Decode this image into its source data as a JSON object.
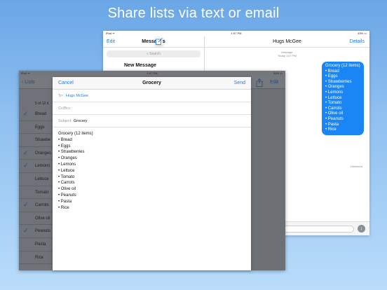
{
  "headline": "Share lists via text or email",
  "messages_ipad": {
    "status": {
      "left": "iPad ᯤ",
      "time": "1:57 PM",
      "battery": "43% ▭"
    },
    "left": {
      "edit": "Edit",
      "title": "Messages",
      "search_placeholder": "Search",
      "new_message": "New Message"
    },
    "right": {
      "contact": "Hugs McGee",
      "details": "Details",
      "meta_service": "Message",
      "meta_time": "Today 1:57 PM",
      "bubble_lines": [
        "Grocery (12 items)",
        "• Bread",
        "• Eggs",
        "• Strawberries",
        "• Oranges",
        "• Lemons",
        "• Lettuce",
        "• Tomato",
        "• Carrots",
        "• Olive oil",
        "• Peanuts",
        "• Pasta",
        "• Rice"
      ],
      "delivered": "Delivered"
    }
  },
  "list_ipad": {
    "status": {
      "left": "iPad ᯤ",
      "time": "1:57 PM",
      "battery": "44% ▭"
    },
    "back_label": "Lists",
    "edit_label": "Edit",
    "count_label": "5 of 12 it",
    "rows": [
      {
        "label": "Bread",
        "checked": true
      },
      {
        "label": "Eggs",
        "checked": false
      },
      {
        "label": "Strawbe",
        "checked": false
      },
      {
        "label": "Oranges",
        "checked": true
      },
      {
        "label": "Lemons",
        "checked": true
      },
      {
        "label": "Lettuce",
        "checked": false
      },
      {
        "label": "Tomato",
        "checked": false
      },
      {
        "label": "Carrots",
        "checked": true
      },
      {
        "label": "Olive oil",
        "checked": false
      },
      {
        "label": "Peanuts",
        "checked": true
      },
      {
        "label": "Pasta",
        "checked": false
      },
      {
        "label": "Rice",
        "checked": false
      }
    ]
  },
  "compose": {
    "cancel": "Cancel",
    "title": "Grocery",
    "send": "Send",
    "to_label": "To:",
    "to_value": "Hugs McGee",
    "ccbcc_label": "Cc/Bcc:",
    "subject_label": "Subject:",
    "subject_value": "Grocery",
    "body_lines": [
      "Grocery (12 items)",
      "• Bread",
      "• Eggs",
      "• Strawberries",
      "• Oranges",
      "• Lemons",
      "• Lettuce",
      "• Tomato",
      "• Carrots",
      "• Olive oil",
      "• Peanuts",
      "• Pasta",
      "• Rice"
    ]
  },
  "colors": {
    "accent": "#1a7cf3",
    "bubble": "#1a86f5",
    "check": "#1b4f8f"
  }
}
